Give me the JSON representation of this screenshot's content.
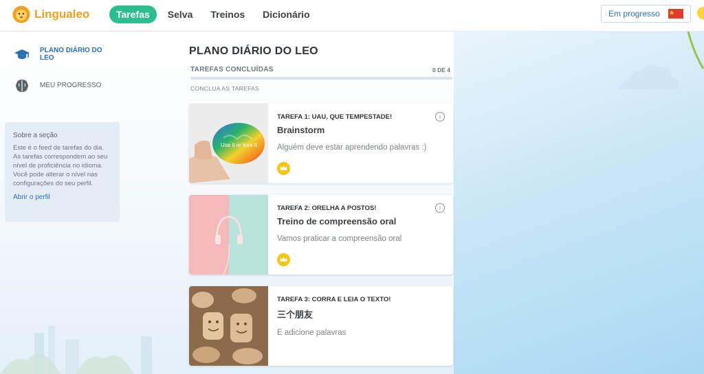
{
  "header": {
    "logo_text": "Lingualeo",
    "nav": [
      {
        "label": "Tarefas",
        "active": true
      },
      {
        "label": "Selva"
      },
      {
        "label": "Treinos"
      },
      {
        "label": "Dicionário"
      }
    ],
    "progress_button": "Em progresso",
    "flag_icon": "china-flag-icon"
  },
  "sidebar": {
    "items": [
      {
        "label": "PLANO DIÁRIO DO LEO",
        "icon": "graduation-cap-icon",
        "active": true
      },
      {
        "label": "MEU PROGRESSO",
        "icon": "brain-icon"
      }
    ],
    "about": {
      "title": "Sobre a seção",
      "text": "Este é o feed de tarefas do dia. As tarefas correspondem ao seu nível de proficiência no idioma. Você pode alterar o nível nas configurações do seu perfil.",
      "link": "Abrir o perfil"
    }
  },
  "main": {
    "title": "PLANO DIÁRIO DO LEO",
    "done_label": "TAREFAS CONCLUÍDAS",
    "done_count": "0 DE 4",
    "progress_fraction": 0,
    "hint": "CONCLUA AS TAREFAS",
    "tasks": [
      {
        "tag": "TAREFA 1: UAU, QUE TEMPESTADE!",
        "title": "Brainstorm",
        "desc": "Alguém deve estar aprendendo palavras :)",
        "image_text": "Use it or lose it"
      },
      {
        "tag": "TAREFA 2: ORELHA A POSTOS!",
        "title": "Treino de compreensão oral",
        "desc": "Vamos praticar a compreensão oral"
      },
      {
        "tag": "TAREFA 3: CORRA E LEIA O TEXTO!",
        "title": "三个朋友",
        "desc": "E adicione palavras"
      }
    ]
  },
  "colors": {
    "accent": "#2ebd8f",
    "link": "#2c6fb4",
    "logo": "#f0a020",
    "crown": "#f5c518"
  }
}
